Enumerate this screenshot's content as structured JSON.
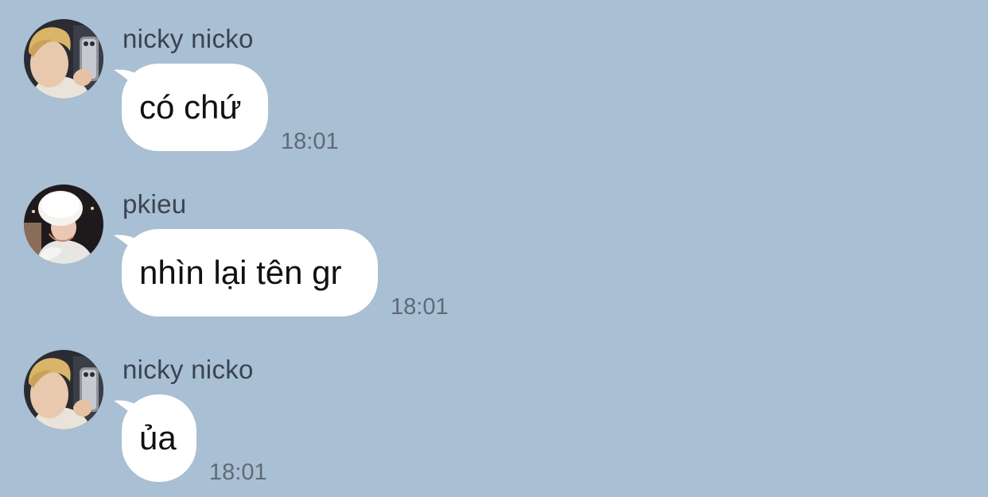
{
  "colors": {
    "background": "#a9bfd3",
    "bubble": "#ffffff",
    "sender_text": "#3a4450",
    "time_text": "#5f6b77"
  },
  "messages": [
    {
      "sender": "nicky nicko",
      "text": "có chứ",
      "time": "18:01",
      "avatar": "avatar-nicky-nicko"
    },
    {
      "sender": "pkieu",
      "text": "nhìn lại tên gr",
      "time": "18:01",
      "avatar": "avatar-pkieu"
    },
    {
      "sender": "nicky nicko",
      "text": "ủa",
      "time": "18:01",
      "avatar": "avatar-nicky-nicko"
    }
  ]
}
